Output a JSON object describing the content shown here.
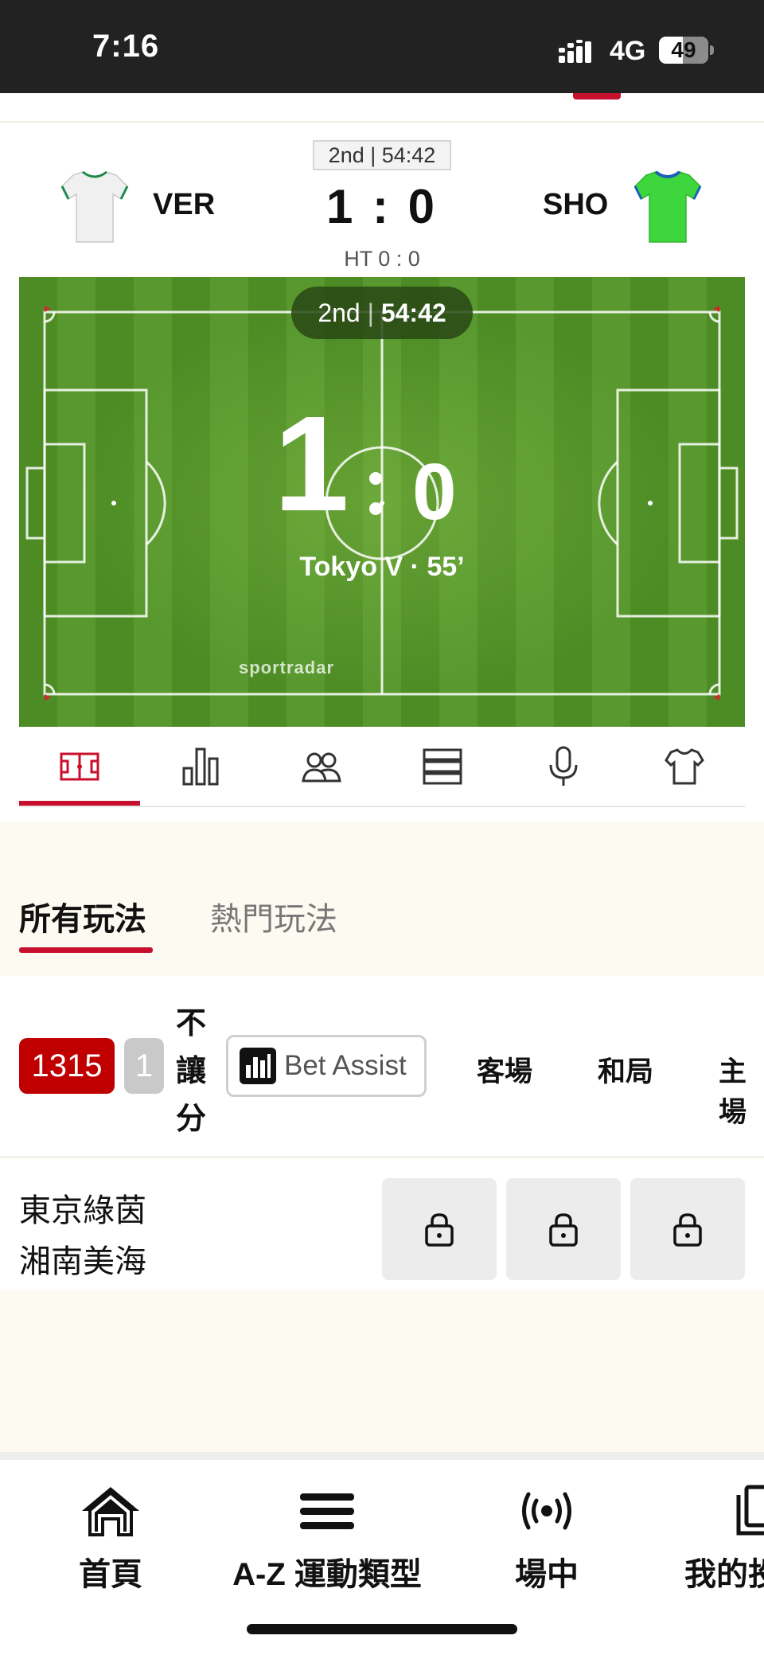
{
  "status_bar": {
    "time": "7:16",
    "network": "4G",
    "battery": "49",
    "battery_level": 0.49
  },
  "match": {
    "period_clock": "2nd | 54:42",
    "home": {
      "code": "VER",
      "jersey_color": "#f2f2f2",
      "trim_color": "#1e8a4a"
    },
    "away": {
      "code": "SHO",
      "jersey_color": "#3dd63d",
      "trim_color": "#1d5fb8"
    },
    "score": "1 : 0",
    "half_time": "HT 0 : 0"
  },
  "pitch": {
    "period": "2nd",
    "clock": "54:42",
    "home_score": "1",
    "away_score": "0",
    "event": "Tokyo V · 55’",
    "brand": "sportradar"
  },
  "icon_tabs": [
    {
      "icon": "pitch-icon",
      "active": true
    },
    {
      "icon": "stats-bar-icon",
      "active": false
    },
    {
      "icon": "lineup-icon",
      "active": false
    },
    {
      "icon": "list-icon",
      "active": false
    },
    {
      "icon": "microphone-icon",
      "active": false
    },
    {
      "icon": "jersey-icon",
      "active": false
    }
  ],
  "market_tabs": {
    "all": "所有玩法",
    "hot": "熱門玩法"
  },
  "filter": {
    "count": "1315",
    "count2": "1",
    "handicap_label": [
      "不",
      "讓",
      "分"
    ],
    "bet_assist": "Bet Assist",
    "columns": [
      "客場",
      "和局",
      "主場"
    ]
  },
  "match_row": {
    "home": "東京綠茵",
    "away": "湘南美海"
  },
  "bottom_nav": [
    {
      "label": "首頁",
      "icon": "home-icon"
    },
    {
      "label": "A-Z 運動類型",
      "icon": "menu-icon"
    },
    {
      "label": "場中",
      "icon": "live-broadcast-icon"
    },
    {
      "label": "我的投",
      "icon": "bet-slip-icon"
    }
  ],
  "colors": {
    "accent": "#c8102e",
    "count_badge": "#c00000",
    "pitch": "#4d8c25"
  }
}
